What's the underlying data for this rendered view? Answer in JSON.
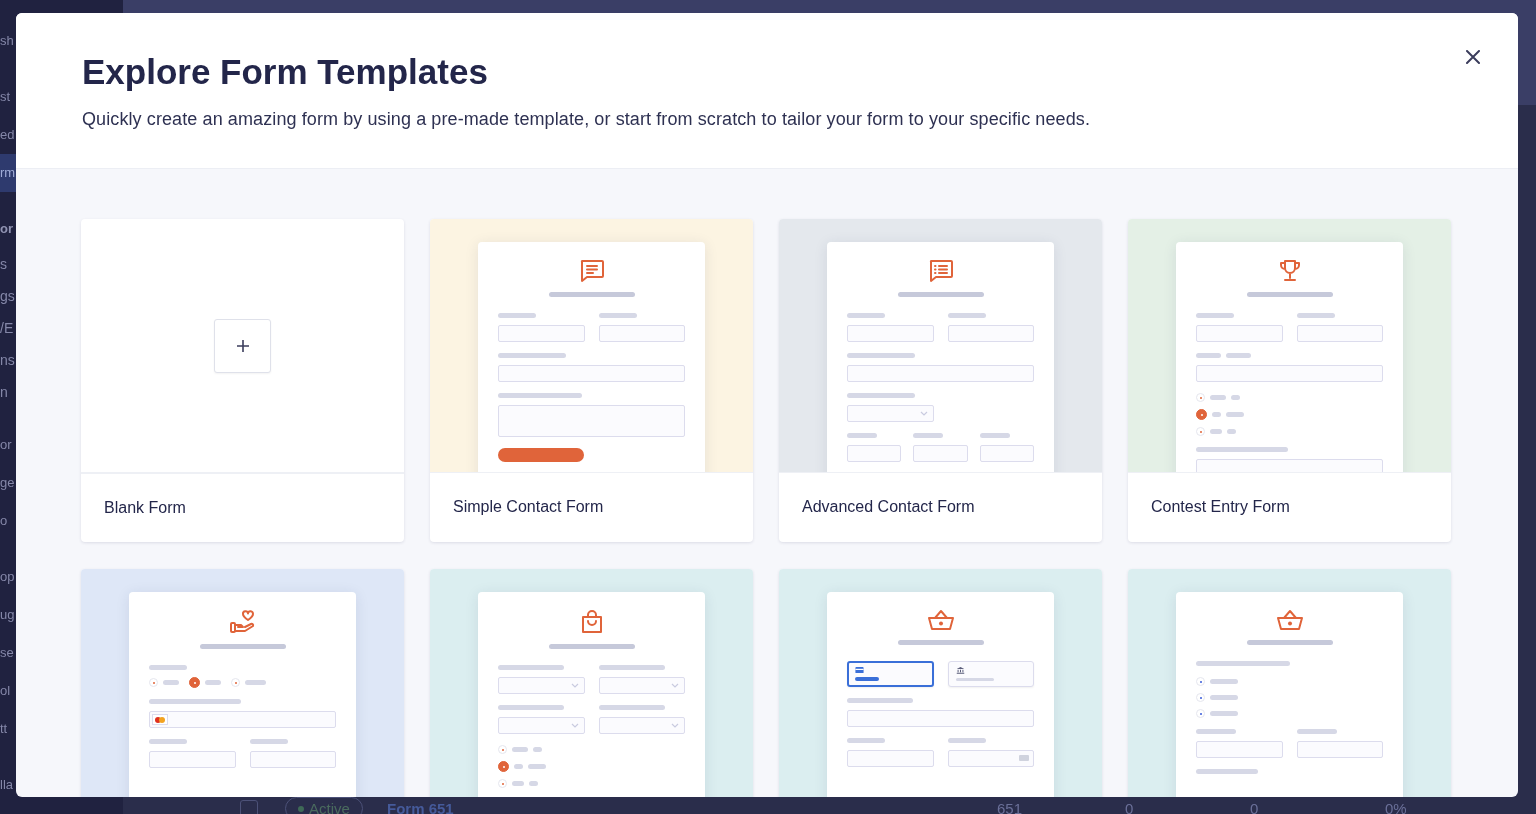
{
  "page": {
    "sidebar": {
      "groups": [
        {
          "items": [
            {
              "kind": "link",
              "label": "sh",
              "selected": false
            }
          ]
        },
        {
          "items": [
            {
              "kind": "link",
              "label": "st",
              "selected": false
            },
            {
              "kind": "link",
              "label": "ed",
              "selected": false
            },
            {
              "kind": "link",
              "label": "rm",
              "selected": true
            }
          ]
        },
        {
          "items": [
            {
              "kind": "heading",
              "label": "or",
              "selected": false
            },
            {
              "kind": "sub",
              "label": "s",
              "selected": false
            },
            {
              "kind": "sub",
              "label": "gs",
              "selected": false
            },
            {
              "kind": "sub",
              "label": "/E",
              "selected": false
            },
            {
              "kind": "sub",
              "label": "ns",
              "selected": false
            },
            {
              "kind": "sub",
              "label": "n",
              "selected": false
            }
          ]
        },
        {
          "items": [
            {
              "kind": "link",
              "label": "or",
              "selected": false
            },
            {
              "kind": "link",
              "label": "ge",
              "selected": false
            },
            {
              "kind": "link",
              "label": "o",
              "selected": false
            }
          ]
        },
        {
          "items": [
            {
              "kind": "link",
              "label": "op",
              "selected": false
            },
            {
              "kind": "link",
              "label": "ug",
              "selected": false
            },
            {
              "kind": "link",
              "label": "se",
              "selected": false
            },
            {
              "kind": "link",
              "label": "ol",
              "selected": false
            },
            {
              "kind": "link",
              "label": "tt",
              "selected": false
            }
          ]
        },
        {
          "items": [
            {
              "kind": "link",
              "label": "lla",
              "selected": false
            }
          ]
        }
      ]
    },
    "table_row": {
      "checked": false,
      "status": "Active",
      "name": "Form 651",
      "cells": [
        "651",
        "0",
        "0",
        "0%"
      ]
    }
  },
  "modal": {
    "title": "Explore Form Templates",
    "subtitle": "Quickly create an amazing form by using a pre-made template, or start from scratch to tailor your form to your specific needs.",
    "templates": [
      {
        "kind": "blank",
        "title": "Blank Form"
      },
      {
        "kind": "contact",
        "title": "Simple Contact Form"
      },
      {
        "kind": "advanced",
        "title": "Advanced Contact Form"
      },
      {
        "kind": "contest",
        "title": "Contest Entry Form"
      },
      {
        "kind": "donation"
      },
      {
        "kind": "order"
      },
      {
        "kind": "payment"
      },
      {
        "kind": "survey"
      }
    ]
  }
}
